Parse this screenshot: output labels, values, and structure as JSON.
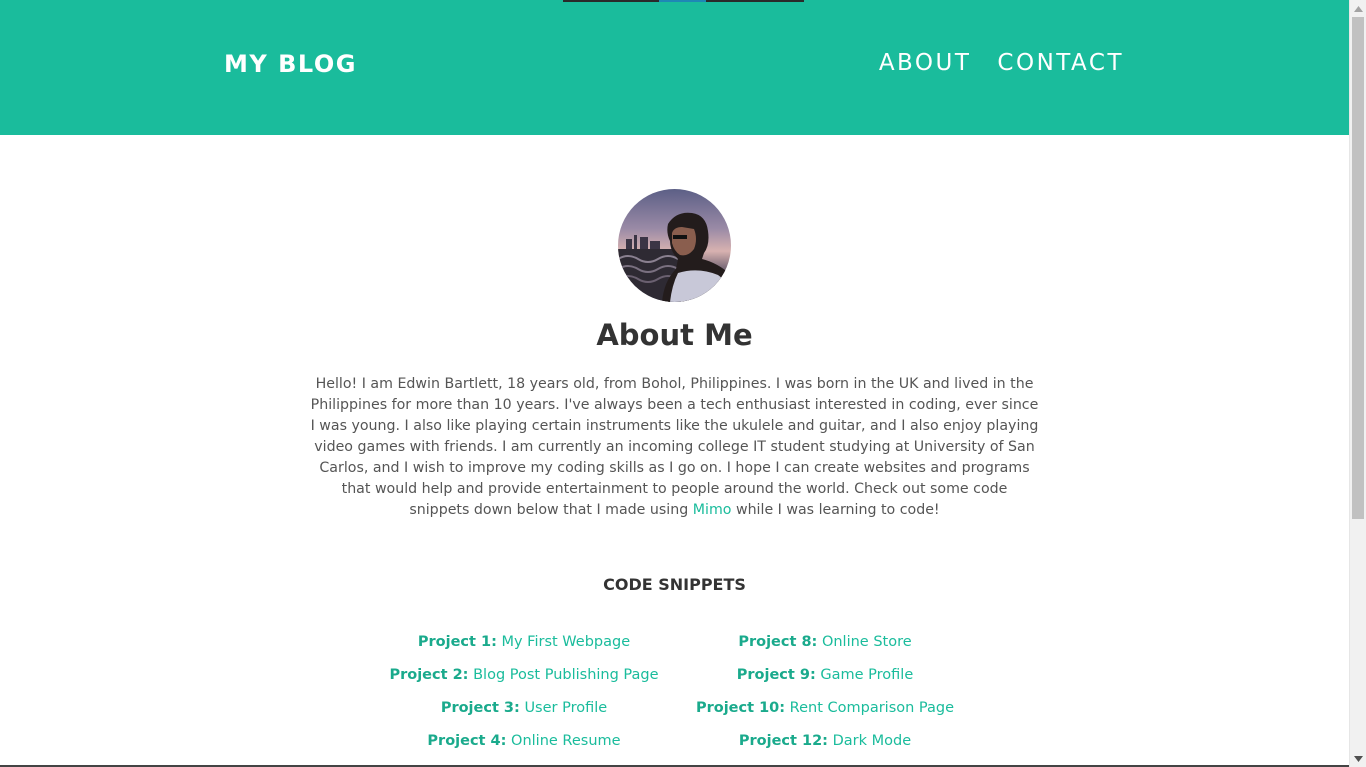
{
  "header": {
    "brand": "MY BLOG",
    "nav": [
      {
        "label": "ABOUT"
      },
      {
        "label": "CONTACT"
      }
    ]
  },
  "about": {
    "title": "About Me",
    "bio_text": "Hello! I am Edwin Bartlett, 18 years old, from Bohol, Philippines. I was born in the UK and lived in the Philippines for more than 10 years. I've always been a tech enthusiast interested in coding, ever since I was young. I also like playing certain instruments like the ukulele and guitar, and I also enjoy playing video games with friends. I am currently an incoming college IT student studying at University of San Carlos, and I wish to improve my coding skills as I go on. I hope I can create websites and programs that would help and provide entertainment to people around the world. Check out some code snippets down below that I made using",
    "link_label": "Mimo",
    "bio_tail": " while I was learning to code!"
  },
  "snippets": {
    "title": "CODE SNIPPETS",
    "left": [
      {
        "num": "Project 1:",
        "name": "My First Webpage"
      },
      {
        "num": "Project 2:",
        "name": "Blog Post Publishing Page"
      },
      {
        "num": "Project 3:",
        "name": "User Profile"
      },
      {
        "num": "Project 4:",
        "name": "Online Resume"
      }
    ],
    "right": [
      {
        "num": "Project 8:",
        "name": "Online Store"
      },
      {
        "num": "Project 9:",
        "name": "Game Profile"
      },
      {
        "num": "Project 10:",
        "name": "Rent Comparison Page"
      },
      {
        "num": "Project 12:",
        "name": "Dark Mode"
      }
    ]
  },
  "colors": {
    "accent": "#1abc9c",
    "text": "#333333",
    "body_text": "#555555"
  },
  "scroll_position": 0.0
}
